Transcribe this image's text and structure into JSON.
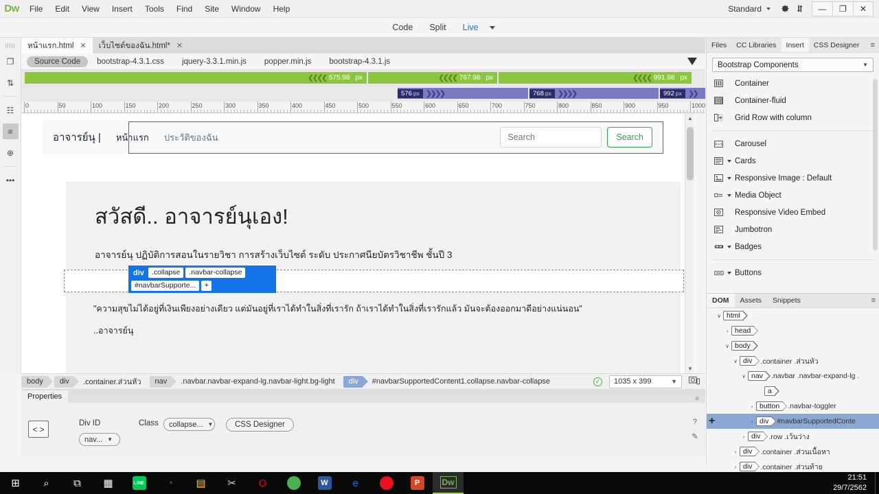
{
  "app": {
    "logo": "Dw",
    "menus": [
      "File",
      "Edit",
      "View",
      "Insert",
      "Tools",
      "Find",
      "Site",
      "Window",
      "Help"
    ],
    "workspace": "Standard",
    "window_buttons": {
      "minimize": "—",
      "restore": "❐",
      "close": "✕"
    }
  },
  "doc_toolbar": {
    "views": [
      {
        "label": "Code",
        "active": false
      },
      {
        "label": "Split",
        "active": false
      },
      {
        "label": "Live",
        "active": true
      }
    ]
  },
  "left_rail": {
    "icons": [
      {
        "name": "new-file-icon",
        "glyph": "❐"
      },
      {
        "name": "sort-arrows-icon",
        "glyph": "⇅"
      },
      {
        "name": "file-inspect-icon",
        "glyph": "☷"
      },
      {
        "name": "align-lines-icon",
        "glyph": "≡"
      },
      {
        "name": "target-icon",
        "glyph": "⊕"
      },
      {
        "name": "more-options-icon",
        "glyph": "•••"
      }
    ]
  },
  "doc_tabs": [
    {
      "label": "หน้าแรก.html",
      "active": true,
      "close": "✕"
    },
    {
      "label": "เว็บไซต์ของฉัน.html*",
      "active": false,
      "close": "✕"
    }
  ],
  "related_files": [
    {
      "label": "Source Code",
      "selected": true
    },
    {
      "label": "bootstrap-4.3.1.css",
      "selected": false
    },
    {
      "label": "jquery-3.3.1.min.js",
      "selected": false
    },
    {
      "label": "popper.min.js",
      "selected": false
    },
    {
      "label": "bootstrap-4.3.1.js",
      "selected": false
    }
  ],
  "media_queries": {
    "max_widths": [
      {
        "value": "575.98",
        "unit": "px"
      },
      {
        "value": "767.98",
        "unit": "px"
      },
      {
        "value": "991.98",
        "unit": "px"
      }
    ],
    "min_widths": [
      {
        "value": "576",
        "unit": "px"
      },
      {
        "value": "768",
        "unit": "px"
      },
      {
        "value": "992",
        "unit": "px"
      }
    ]
  },
  "ruler": {
    "labels": [
      "0",
      "50",
      "100",
      "150",
      "200",
      "250",
      "300",
      "350",
      "400",
      "450",
      "500",
      "550",
      "600",
      "650",
      "700",
      "750",
      "800",
      "850",
      "900",
      "950",
      "1000"
    ]
  },
  "live_page": {
    "navbar": {
      "brand": "อาจารย์นุ |",
      "links": [
        "หน้าแรก",
        "ประวัติของฉัน"
      ],
      "search_placeholder": "Search",
      "search_button": "Search"
    },
    "hud": {
      "tag": "div",
      "class1": ".collapse",
      "class2": ".navbar-collapse",
      "id": "#navbarSupporte...",
      "add": "+"
    },
    "heading": "สวัสดี.. อาจารย์นุเอง!",
    "lead": "อาจารย์นุ ปฏิบัติการสอนในรายวิชา การสร้างเว็บไซต์ ระดับ ประกาศนียบัตรวิชาชีพ ชั้นปี 3",
    "quote": "\"ความสุขไม่ได้อยู่ที่เงินเพียงอย่างเดียว แต่มันอยู่ที่เราได้ทำในสิ่งที่เรารัก ถ้าเราได้ทำในสิ่งที่เรารักแล้ว มันจะต้องออกมาดีอย่างแน่นอน\"",
    "quote_author": "..อาจารย์นุ"
  },
  "status_bar": {
    "crumbs": [
      {
        "tag": "body",
        "cls": "",
        "selected": false
      },
      {
        "tag": "div",
        "cls": ".container.ส่วนหัว",
        "selected": false
      },
      {
        "tag": "nav",
        "cls": ".navbar.navbar-expand-lg.navbar-light.bg-light",
        "selected": false
      },
      {
        "tag": "div",
        "cls": "#navbarSupportedContent1.collapse.navbar-collapse",
        "selected": true
      }
    ],
    "size": "1035 x 399",
    "status_ok": "✓"
  },
  "properties": {
    "tab_label": "Properties",
    "code_icon": "< >",
    "div_id_label": "Div ID",
    "div_id_value": "nav...",
    "class_label": "Class",
    "class_value": "collapse...",
    "css_designer_button": "CSS Designer",
    "help": "?",
    "edit": "✎"
  },
  "right_dock": {
    "panel_tabs": [
      {
        "label": "Files",
        "active": false
      },
      {
        "label": "CC Libraries",
        "active": false
      },
      {
        "label": "Insert",
        "active": true
      },
      {
        "label": "CSS Designer",
        "active": false
      }
    ],
    "insert_category": "Bootstrap Components",
    "insert_items": [
      {
        "label": "Container",
        "icon": "container-icon",
        "has_arrow": false,
        "divider_after": false
      },
      {
        "label": "Container-fluid",
        "icon": "container-fluid-icon",
        "has_arrow": false,
        "divider_after": false
      },
      {
        "label": "Grid Row with column",
        "icon": "grid-row-icon",
        "has_arrow": false,
        "divider_after": true
      },
      {
        "label": "Carousel",
        "icon": "carousel-icon",
        "has_arrow": false,
        "divider_after": false
      },
      {
        "label": "Cards",
        "icon": "cards-icon",
        "has_arrow": true,
        "divider_after": false
      },
      {
        "label": "Responsive Image : Default",
        "icon": "image-icon",
        "has_arrow": true,
        "divider_after": false
      },
      {
        "label": "Media Object",
        "icon": "media-object-icon",
        "has_arrow": true,
        "divider_after": false
      },
      {
        "label": "Responsive Video Embed",
        "icon": "video-embed-icon",
        "has_arrow": false,
        "divider_after": false
      },
      {
        "label": "Jumbotron",
        "icon": "jumbotron-icon",
        "has_arrow": false,
        "divider_after": false
      },
      {
        "label": "Badges",
        "icon": "badges-icon",
        "has_arrow": true,
        "divider_after": true
      },
      {
        "label": "Buttons",
        "icon": "buttons-icon",
        "has_arrow": true,
        "divider_after": false
      }
    ],
    "dom_tabs": [
      {
        "label": "DOM",
        "active": true
      },
      {
        "label": "Assets",
        "active": false
      },
      {
        "label": "Snippets",
        "active": false
      }
    ],
    "dom_tree": [
      {
        "tag": "html",
        "cls": "",
        "indent": 1,
        "chev": "∨",
        "selected": false
      },
      {
        "tag": "head",
        "cls": "",
        "indent": 2,
        "chev": "›",
        "selected": false
      },
      {
        "tag": "body",
        "cls": "",
        "indent": 2,
        "chev": "∨",
        "selected": false
      },
      {
        "tag": "div",
        "cls": ".container .ส่วนหัว",
        "indent": 3,
        "chev": "∨",
        "selected": false
      },
      {
        "tag": "nav",
        "cls": ".navbar .navbar-expand-lg .",
        "indent": 4,
        "chev": "∨",
        "selected": false
      },
      {
        "tag": "a",
        "cls": "",
        "indent": 6,
        "chev": "",
        "selected": false
      },
      {
        "tag": "button",
        "cls": ".navbar-toggler",
        "indent": 5,
        "chev": "›",
        "selected": false
      },
      {
        "tag": "div",
        "cls": "#navbarSupportedConte",
        "indent": 5,
        "chev": "›",
        "selected": true
      },
      {
        "tag": "div",
        "cls": ".row .เว้นว่าง",
        "indent": 4,
        "chev": "›",
        "selected": false
      },
      {
        "tag": "div",
        "cls": ".container .ส่วนเนื้อหา",
        "indent": 3,
        "chev": "›",
        "selected": false
      },
      {
        "tag": "div",
        "cls": ".container .ส่วนท้าย",
        "indent": 3,
        "chev": "›",
        "selected": false
      }
    ]
  },
  "taskbar": {
    "items": [
      {
        "name": "start-button",
        "glyph": "⊞",
        "color": "#ffffff",
        "shape": "plain"
      },
      {
        "name": "search-icon",
        "glyph": "⌕",
        "color": "#ffffff",
        "shape": "plain"
      },
      {
        "name": "task-view-icon",
        "glyph": "⧉",
        "color": "#ffffff",
        "shape": "plain"
      },
      {
        "name": "calculator-icon",
        "glyph": "▦",
        "color": "#ffffff",
        "shape": "plain"
      },
      {
        "name": "line-app-icon",
        "glyph": "LINE",
        "color": "#06c755",
        "shape": "square"
      },
      {
        "name": "adobe-app-icon",
        "glyph": "◔",
        "color": "#5a5a5a",
        "shape": "plain"
      },
      {
        "name": "file-explorer-icon",
        "glyph": "▤",
        "color": "#ffc83d",
        "shape": "plain"
      },
      {
        "name": "snipping-tool-icon",
        "glyph": "✂",
        "color": "#d9d9d9",
        "shape": "plain"
      },
      {
        "name": "opera-icon",
        "glyph": "O",
        "color": "#e3000f",
        "shape": "plain"
      },
      {
        "name": "chrome-icon",
        "glyph": "◉",
        "color": "#4caf50",
        "shape": "circle"
      },
      {
        "name": "word-icon",
        "glyph": "W",
        "color": "#2b579a",
        "shape": "square"
      },
      {
        "name": "edge-icon",
        "glyph": "e",
        "color": "#0078d7",
        "shape": "plain"
      },
      {
        "name": "recorder-icon",
        "glyph": "●",
        "color": "#e81123",
        "shape": "circle"
      },
      {
        "name": "powerpoint-icon",
        "glyph": "P",
        "color": "#d24726",
        "shape": "square"
      },
      {
        "name": "dreamweaver-icon",
        "glyph": "Dw",
        "color": "#7ab648",
        "shape": "active"
      }
    ],
    "time": "21:51",
    "date": "29/7/2562"
  }
}
